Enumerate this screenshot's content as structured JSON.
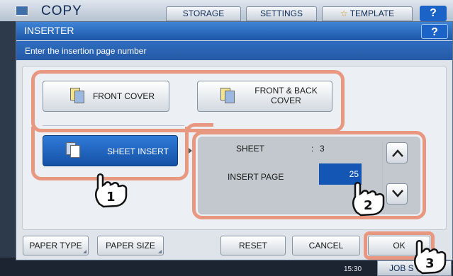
{
  "app": {
    "title": "COPY",
    "icon": "copy-icon"
  },
  "top_tabs": {
    "storage": "STORAGE",
    "settings": "SETTINGS",
    "template": "TEMPLATE",
    "help": "?"
  },
  "dialog": {
    "title": "INSERTER",
    "help": "?",
    "message": "Enter the insertion page number"
  },
  "options": {
    "front_cover": "FRONT COVER",
    "front_back_cover_line1": "FRONT & BACK",
    "front_back_cover_line2": "COVER",
    "sheet_insert": "SHEET INSERT"
  },
  "panel": {
    "sheet_label": "SHEET",
    "sheet_colon": ":",
    "sheet_value": "3",
    "insert_page_label": "INSERT PAGE",
    "insert_page_value": "25"
  },
  "bottom_buttons": {
    "paper_type": "PAPER TYPE",
    "paper_size": "PAPER SIZE",
    "reset": "RESET",
    "cancel": "CANCEL",
    "ok": "OK"
  },
  "status": {
    "clock": "15:30",
    "job_status_tab": "JOB S"
  },
  "callouts": [
    "1",
    "2",
    "3"
  ],
  "colors": {
    "accent": "#1b63c7",
    "selected": "#1552a6",
    "highlight_ring": "#e89781"
  }
}
